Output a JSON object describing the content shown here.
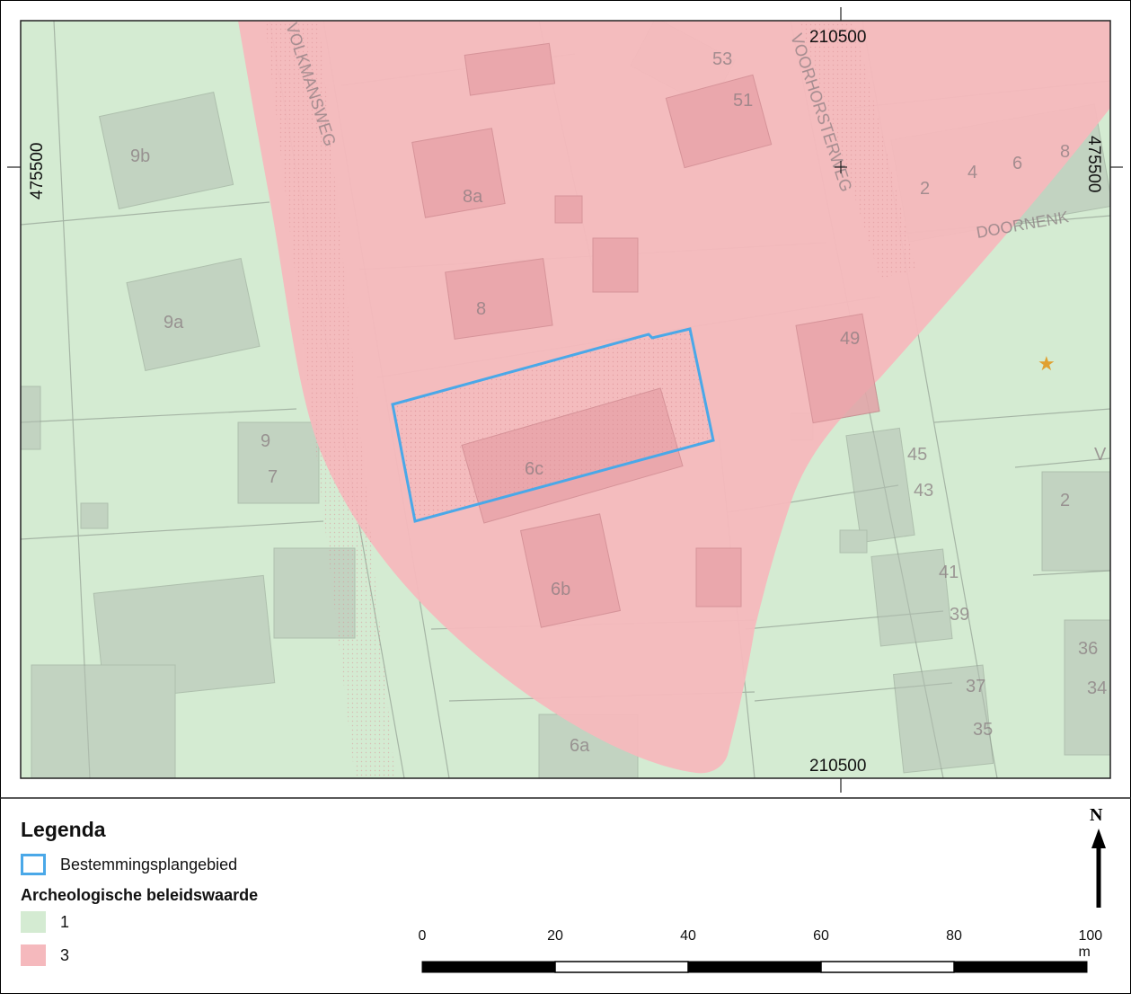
{
  "map": {
    "coordinates": {
      "x_top": "210500",
      "x_bottom": "210500",
      "y_left": "475500",
      "y_right": "475500"
    },
    "street_names": [
      "VOLKMANSWEG",
      "VOORHORSTERWEG",
      "DOORNENK",
      "V"
    ],
    "house_numbers": [
      "9b",
      "9a",
      "9",
      "7",
      "8a",
      "8",
      "53",
      "51",
      "2",
      "4",
      "6",
      "8",
      "49",
      "6c",
      "6b",
      "6a",
      "45",
      "43",
      "41",
      "39",
      "37",
      "35",
      "2",
      "36",
      "34"
    ],
    "colors": {
      "value_1": "#d4ebd2",
      "value_3": "#f5b9bd",
      "plan_area_outline": "#4aa8e8"
    }
  },
  "legend": {
    "title": "Legenda",
    "plan_area_label": "Bestemmingsplangebied",
    "category_title": "Archeologische beleidswaarde",
    "items": [
      {
        "label": "1",
        "color": "#d4ebd2"
      },
      {
        "label": "3",
        "color": "#f5b9bd"
      }
    ]
  },
  "north_arrow": {
    "label": "N"
  },
  "scale_bar": {
    "labels": [
      "0",
      "20",
      "40",
      "60",
      "80",
      "100 m"
    ]
  }
}
